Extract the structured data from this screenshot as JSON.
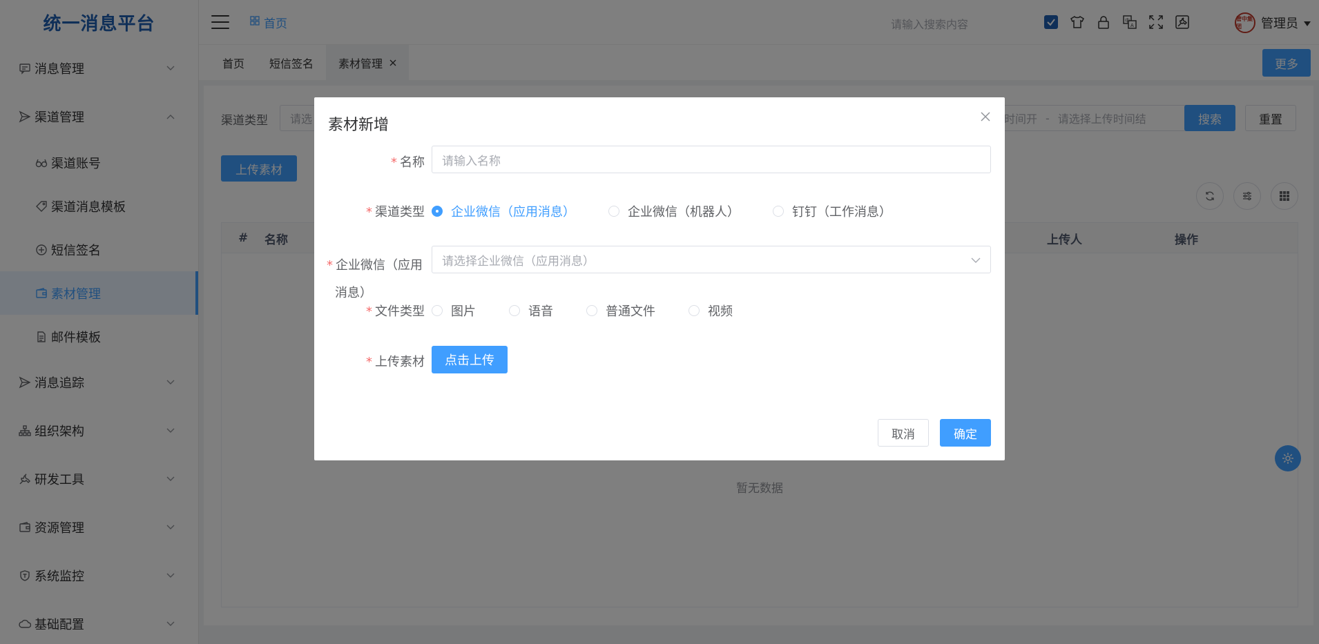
{
  "app": {
    "title": "统一消息平台"
  },
  "header": {
    "breadcrumb": "首页",
    "search_placeholder": "请输入搜索内容",
    "user_name": "管理员",
    "avatar_text": "管中集团"
  },
  "sidebar": {
    "items": [
      {
        "label": "消息管理",
        "icon": "message-icon",
        "expanded": false
      },
      {
        "label": "渠道管理",
        "icon": "send-icon",
        "expanded": true,
        "children": [
          {
            "label": "渠道账号",
            "icon": "glasses-icon"
          },
          {
            "label": "渠道消息模板",
            "icon": "tag-icon"
          },
          {
            "label": "短信签名",
            "icon": "plus-circle-icon"
          },
          {
            "label": "素材管理",
            "icon": "wallet-icon",
            "active": true
          },
          {
            "label": "邮件模板",
            "icon": "document-icon"
          }
        ]
      },
      {
        "label": "消息追踪",
        "icon": "send-icon",
        "expanded": false
      },
      {
        "label": "组织架构",
        "icon": "org-icon",
        "expanded": false
      },
      {
        "label": "研发工具",
        "icon": "tool-icon",
        "expanded": false
      },
      {
        "label": "资源管理",
        "icon": "wallet-icon",
        "expanded": false
      },
      {
        "label": "系统监控",
        "icon": "shield-icon",
        "expanded": false
      },
      {
        "label": "基础配置",
        "icon": "cloud-icon",
        "expanded": false
      }
    ]
  },
  "tabs": [
    {
      "label": "首页"
    },
    {
      "label": "短信签名"
    },
    {
      "label": "素材管理",
      "active": true,
      "closable": true
    }
  ],
  "tabs_more": "更多",
  "main": {
    "filter_label": "渠道类型",
    "filter_placeholder": "请选",
    "date_start": "时间开",
    "date_sep": "-",
    "date_end_placeholder": "请选择上传时间结",
    "search_btn": "搜索",
    "reset_btn": "重置",
    "upload_btn": "上传素材",
    "table_headers": [
      "#",
      "名称",
      "上传人",
      "操作"
    ],
    "empty_text": "暂无数据"
  },
  "dialog": {
    "title": "素材新增",
    "name_label": "名称",
    "name_placeholder": "请输入名称",
    "channel_label": "渠道类型",
    "channel_options": [
      "企业微信（应用消息）",
      "企业微信（机器人）",
      "钉钉（工作消息）"
    ],
    "channel_selected": 0,
    "wecom_label_line1": "企业微信（应用",
    "wecom_label_line2": "消息）",
    "wecom_placeholder": "请选择企业微信（应用消息）",
    "filetype_label": "文件类型",
    "filetype_options": [
      "图片",
      "语音",
      "普通文件",
      "视频"
    ],
    "upload_label": "上传素材",
    "upload_btn": "点击上传",
    "cancel_btn": "取消",
    "ok_btn": "确定"
  },
  "colors": {
    "primary": "#409eff",
    "brand": "#1f5fb0",
    "required": "#f56c6c"
  }
}
